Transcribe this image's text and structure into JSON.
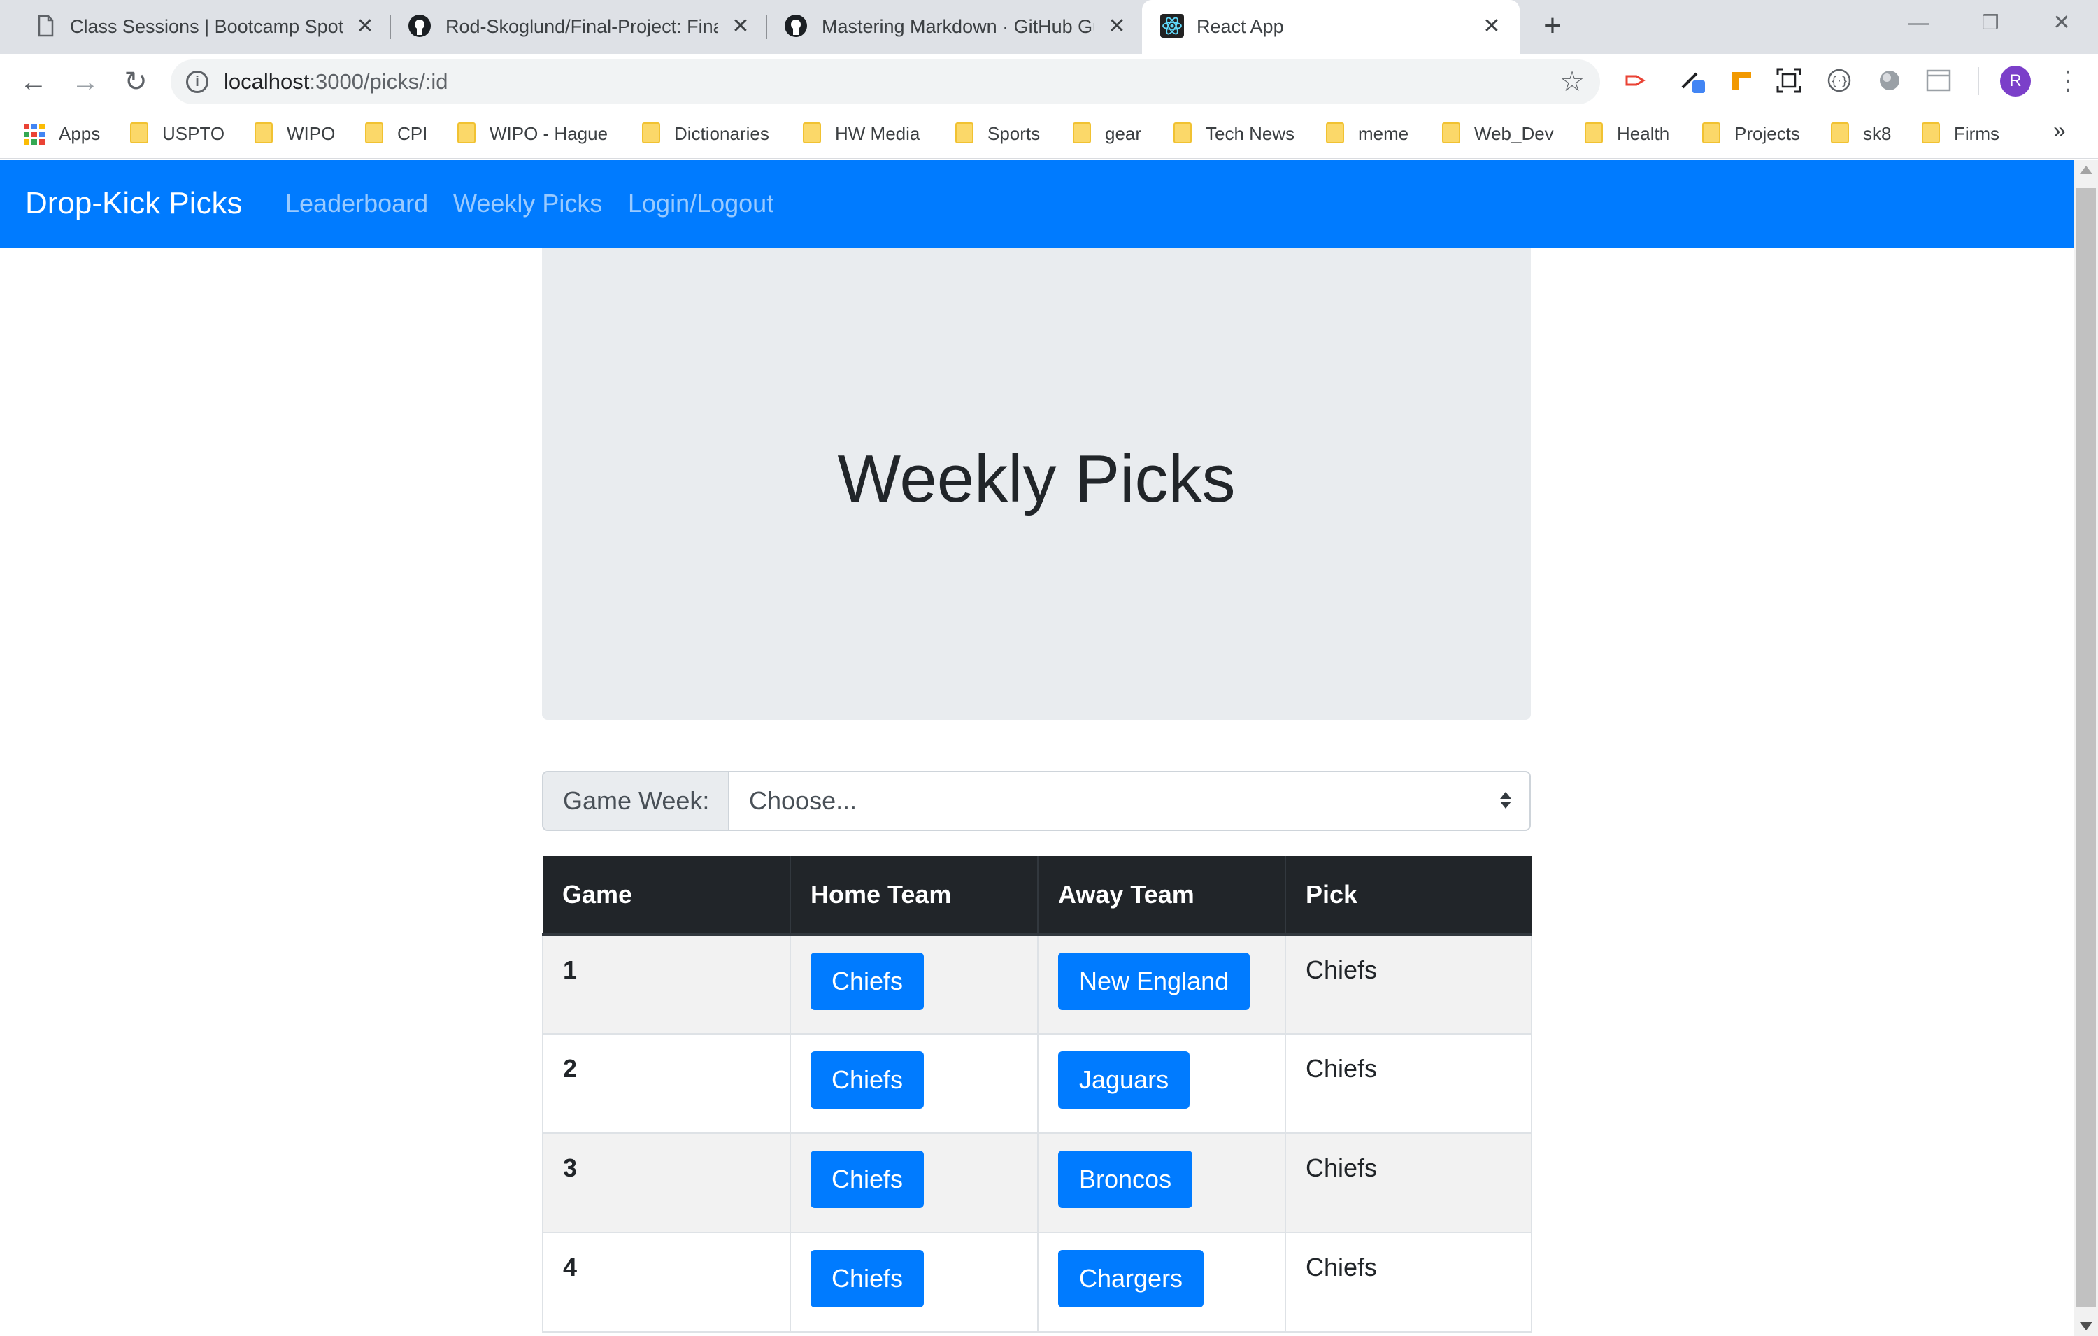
{
  "browser": {
    "tabs": [
      {
        "title": "Class Sessions | Bootcamp Spot",
        "active": false
      },
      {
        "title": "Rod-Skoglund/Final-Project: Fina",
        "active": false
      },
      {
        "title": "Mastering Markdown · GitHub Gu",
        "active": false
      },
      {
        "title": "React App",
        "active": true
      }
    ],
    "url_host": "localhost",
    "url_path": ":3000/picks/:id",
    "avatar_letter": "R",
    "bookmarks": [
      "Apps",
      "USPTO",
      "WIPO",
      "CPI",
      "WIPO - Hague",
      "Dictionaries",
      "HW Media",
      "Sports",
      "gear",
      "Tech News",
      "meme",
      "Web_Dev",
      "Health",
      "Projects",
      "sk8",
      "Firms"
    ],
    "bookmarks_more": "»"
  },
  "app": {
    "brand": "Drop-Kick Picks",
    "nav": [
      "Leaderboard",
      "Weekly Picks",
      "Login/Logout"
    ],
    "accent_color": "#007bff",
    "jumbotron_title": "Weekly Picks",
    "week_select": {
      "label": "Game Week:",
      "value": "Choose..."
    },
    "table": {
      "headers": [
        "Game",
        "Home Team",
        "Away Team",
        "Pick"
      ],
      "rows": [
        {
          "game": "1",
          "home": "Chiefs",
          "away": "New England",
          "pick": "Chiefs"
        },
        {
          "game": "2",
          "home": "Chiefs",
          "away": "Jaguars",
          "pick": "Chiefs"
        },
        {
          "game": "3",
          "home": "Chiefs",
          "away": "Broncos",
          "pick": "Chiefs"
        },
        {
          "game": "4",
          "home": "Chiefs",
          "away": "Chargers",
          "pick": "Chiefs"
        }
      ]
    }
  }
}
